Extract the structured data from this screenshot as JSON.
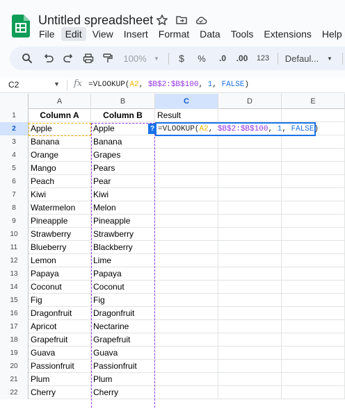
{
  "doc": {
    "title": "Untitled spreadsheet",
    "menu": [
      "File",
      "Edit",
      "View",
      "Insert",
      "Format",
      "Data",
      "Tools",
      "Extensions",
      "Help"
    ],
    "active_menu": "Edit"
  },
  "toolbar": {
    "zoom": "100%",
    "currency": "$",
    "percent": "%",
    "decrease_decimal": ".0",
    "increase_decimal": ".00",
    "number_format": "123",
    "font": "Defaul..."
  },
  "formula_bar": {
    "name_box": "C2",
    "fx": "fx",
    "formula": "=VLOOKUP(A2, $B$2:$B$100, 1, FALSE)"
  },
  "columns": [
    "A",
    "B",
    "C",
    "D",
    "E"
  ],
  "selected_column": "C",
  "rows": [
    {
      "n": "1",
      "a": "Column A",
      "b": "Column B",
      "c": "Result"
    },
    {
      "n": "2",
      "a": "Apple",
      "b": "Apple",
      "c": ""
    },
    {
      "n": "3",
      "a": "Banana",
      "b": "Banana",
      "c": ""
    },
    {
      "n": "4",
      "a": "Orange",
      "b": "Grapes",
      "c": ""
    },
    {
      "n": "5",
      "a": "Mango",
      "b": "Pears",
      "c": ""
    },
    {
      "n": "6",
      "a": "Peach",
      "b": "Pear",
      "c": ""
    },
    {
      "n": "7",
      "a": "Kiwi",
      "b": "Kiwi",
      "c": ""
    },
    {
      "n": "8",
      "a": "Watermelon",
      "b": "Melon",
      "c": ""
    },
    {
      "n": "9",
      "a": "Pineapple",
      "b": "Pineapple",
      "c": ""
    },
    {
      "n": "10",
      "a": "Strawberry",
      "b": "Strawberry",
      "c": ""
    },
    {
      "n": "11",
      "a": "Blueberry",
      "b": "Blackberry",
      "c": ""
    },
    {
      "n": "12",
      "a": "Lemon",
      "b": "Lime",
      "c": ""
    },
    {
      "n": "13",
      "a": "Papaya",
      "b": "Papaya",
      "c": ""
    },
    {
      "n": "14",
      "a": "Coconut",
      "b": "Coconut",
      "c": ""
    },
    {
      "n": "15",
      "a": "Fig",
      "b": "Fig",
      "c": ""
    },
    {
      "n": "16",
      "a": "Dragonfruit",
      "b": "Dragonfruit",
      "c": ""
    },
    {
      "n": "17",
      "a": "Apricot",
      "b": "Nectarine",
      "c": ""
    },
    {
      "n": "18",
      "a": "Grapefruit",
      "b": "Grapefruit",
      "c": ""
    },
    {
      "n": "19",
      "a": "Guava",
      "b": "Guava",
      "c": ""
    },
    {
      "n": "20",
      "a": "Passionfruit",
      "b": "Passionfruit",
      "c": ""
    },
    {
      "n": "21",
      "a": "Plum",
      "b": "Plum",
      "c": ""
    },
    {
      "n": "22",
      "a": "Cherry",
      "b": "Cherry",
      "c": ""
    }
  ],
  "editor": {
    "cell": "C2",
    "help_badge": "?",
    "fn": "=VLOOKUP(",
    "arg1": "A2",
    "sep1": ", ",
    "arg2": "$B$2:$B$100",
    "sep2": ", ",
    "arg3": "1",
    "sep3": ", ",
    "arg4": "FALSE",
    "close": ")"
  },
  "colors": {
    "brand_green": "#0f9d58",
    "selection_blue": "#1a73e8",
    "range1": "#f4b400",
    "range2": "#9334e6"
  }
}
